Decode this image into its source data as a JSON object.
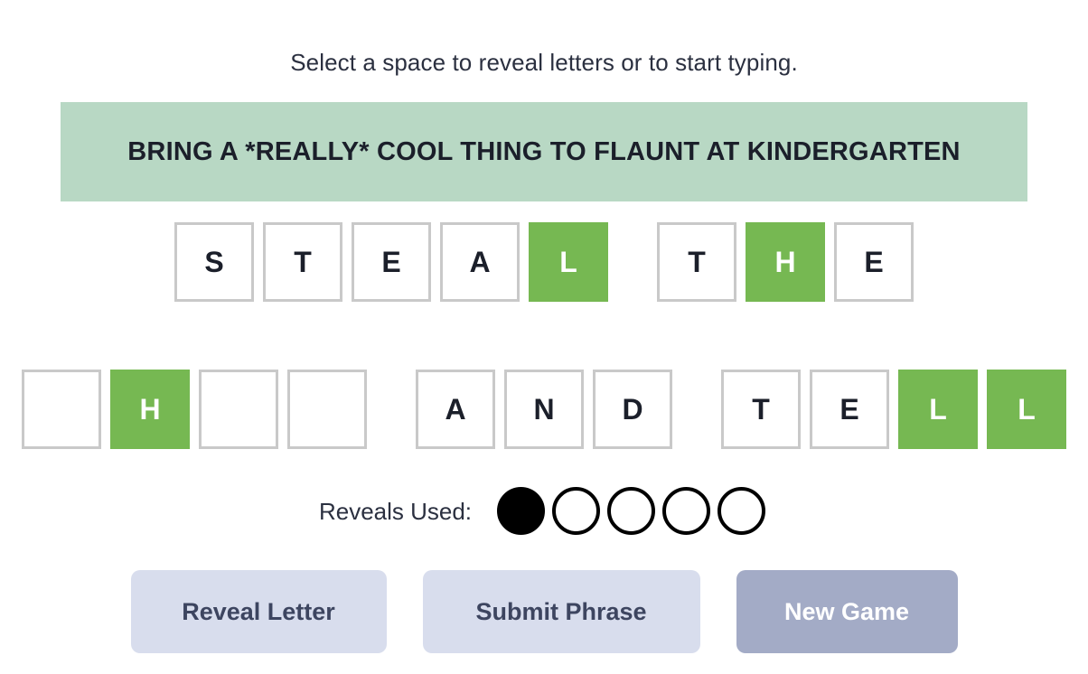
{
  "instruction": "Select a space to reveal letters or to start typing.",
  "phrase_banner": {
    "text": "BRING A *REALLY* COOL THING TO FLAUNT AT KINDERGARTEN",
    "background_color": "#b8d8c4"
  },
  "colors": {
    "revealed_tile": "#76b852",
    "blank_tile_border": "#c9c9c9",
    "letter_dark": "#1b1f2a",
    "button_light": "#d8dded",
    "button_accent": "#a3abc6"
  },
  "answer_rows": [
    {
      "words": [
        {
          "tiles": [
            {
              "letter": "S",
              "revealed": false
            },
            {
              "letter": "T",
              "revealed": false
            },
            {
              "letter": "E",
              "revealed": false
            },
            {
              "letter": "A",
              "revealed": false
            },
            {
              "letter": "L",
              "revealed": true
            }
          ]
        },
        {
          "tiles": [
            {
              "letter": "T",
              "revealed": false
            },
            {
              "letter": "H",
              "revealed": true
            },
            {
              "letter": "E",
              "revealed": false
            }
          ]
        }
      ]
    },
    {
      "words": [
        {
          "tiles": [
            {
              "letter": "",
              "revealed": false
            },
            {
              "letter": "H",
              "revealed": true
            },
            {
              "letter": "",
              "revealed": false
            },
            {
              "letter": "",
              "revealed": false
            }
          ]
        },
        {
          "tiles": [
            {
              "letter": "A",
              "revealed": false
            },
            {
              "letter": "N",
              "revealed": false
            },
            {
              "letter": "D",
              "revealed": false
            }
          ]
        },
        {
          "tiles": [
            {
              "letter": "T",
              "revealed": false
            },
            {
              "letter": "E",
              "revealed": false
            },
            {
              "letter": "L",
              "revealed": true
            },
            {
              "letter": "L",
              "revealed": true
            }
          ]
        }
      ]
    }
  ],
  "reveals": {
    "label": "Reveals Used:",
    "total": 5,
    "used": 1,
    "dots": [
      true,
      false,
      false,
      false,
      false
    ]
  },
  "buttons": [
    {
      "label": "Reveal Letter",
      "name": "reveal-letter-button",
      "style": "light"
    },
    {
      "label": "Submit Phrase",
      "name": "submit-phrase-button",
      "style": "light"
    },
    {
      "label": "New Game",
      "name": "new-game-button",
      "style": "accent"
    }
  ]
}
